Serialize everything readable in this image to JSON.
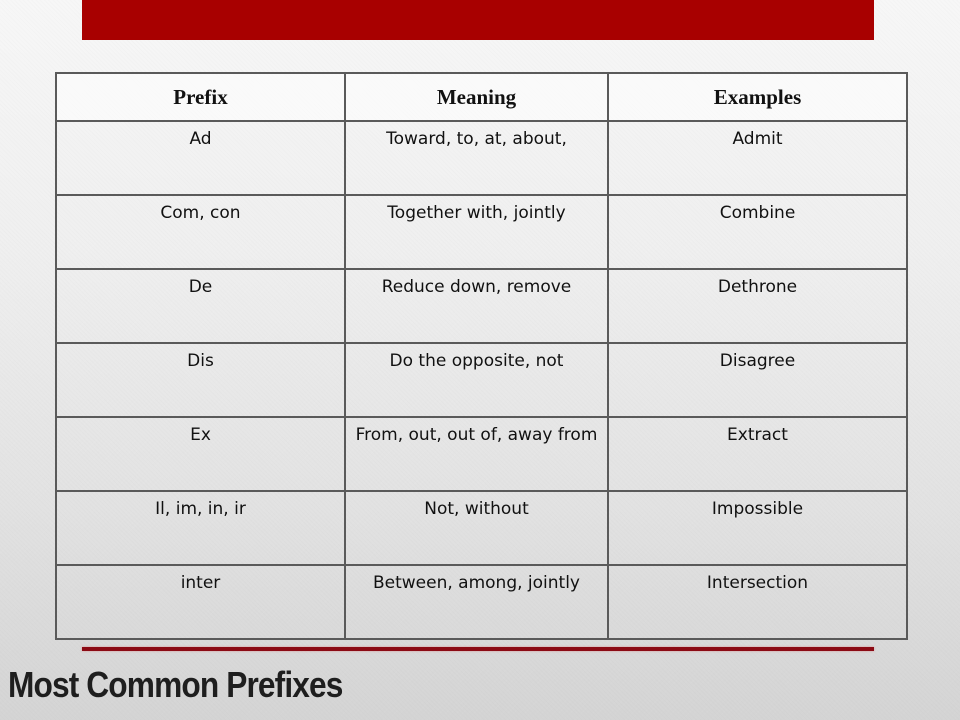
{
  "slide": {
    "title": "Most Common Prefixes",
    "colors": {
      "top_bar": "#a80000",
      "bottom_rule": "#8b0a14",
      "title_text": "#1e1e1e",
      "table_border": "#5a5a5a"
    }
  },
  "table": {
    "headers": [
      "Prefix",
      "Meaning",
      "Examples"
    ],
    "rows": [
      {
        "prefix": "Ad",
        "meaning": "Toward, to, at, about,",
        "example": "Admit"
      },
      {
        "prefix": "Com, con",
        "meaning": "Together with, jointly",
        "example": "Combine"
      },
      {
        "prefix": "De",
        "meaning": "Reduce down, remove",
        "example": "Dethrone"
      },
      {
        "prefix": "Dis",
        "meaning": "Do the opposite, not",
        "example": "Disagree"
      },
      {
        "prefix": "Ex",
        "meaning": "From, out, out of, away from",
        "example": "Extract"
      },
      {
        "prefix": "Il, im, in, ir",
        "meaning": "Not, without",
        "example": "Impossible"
      },
      {
        "prefix": "inter",
        "meaning": "Between, among, jointly",
        "example": "Intersection"
      }
    ]
  }
}
